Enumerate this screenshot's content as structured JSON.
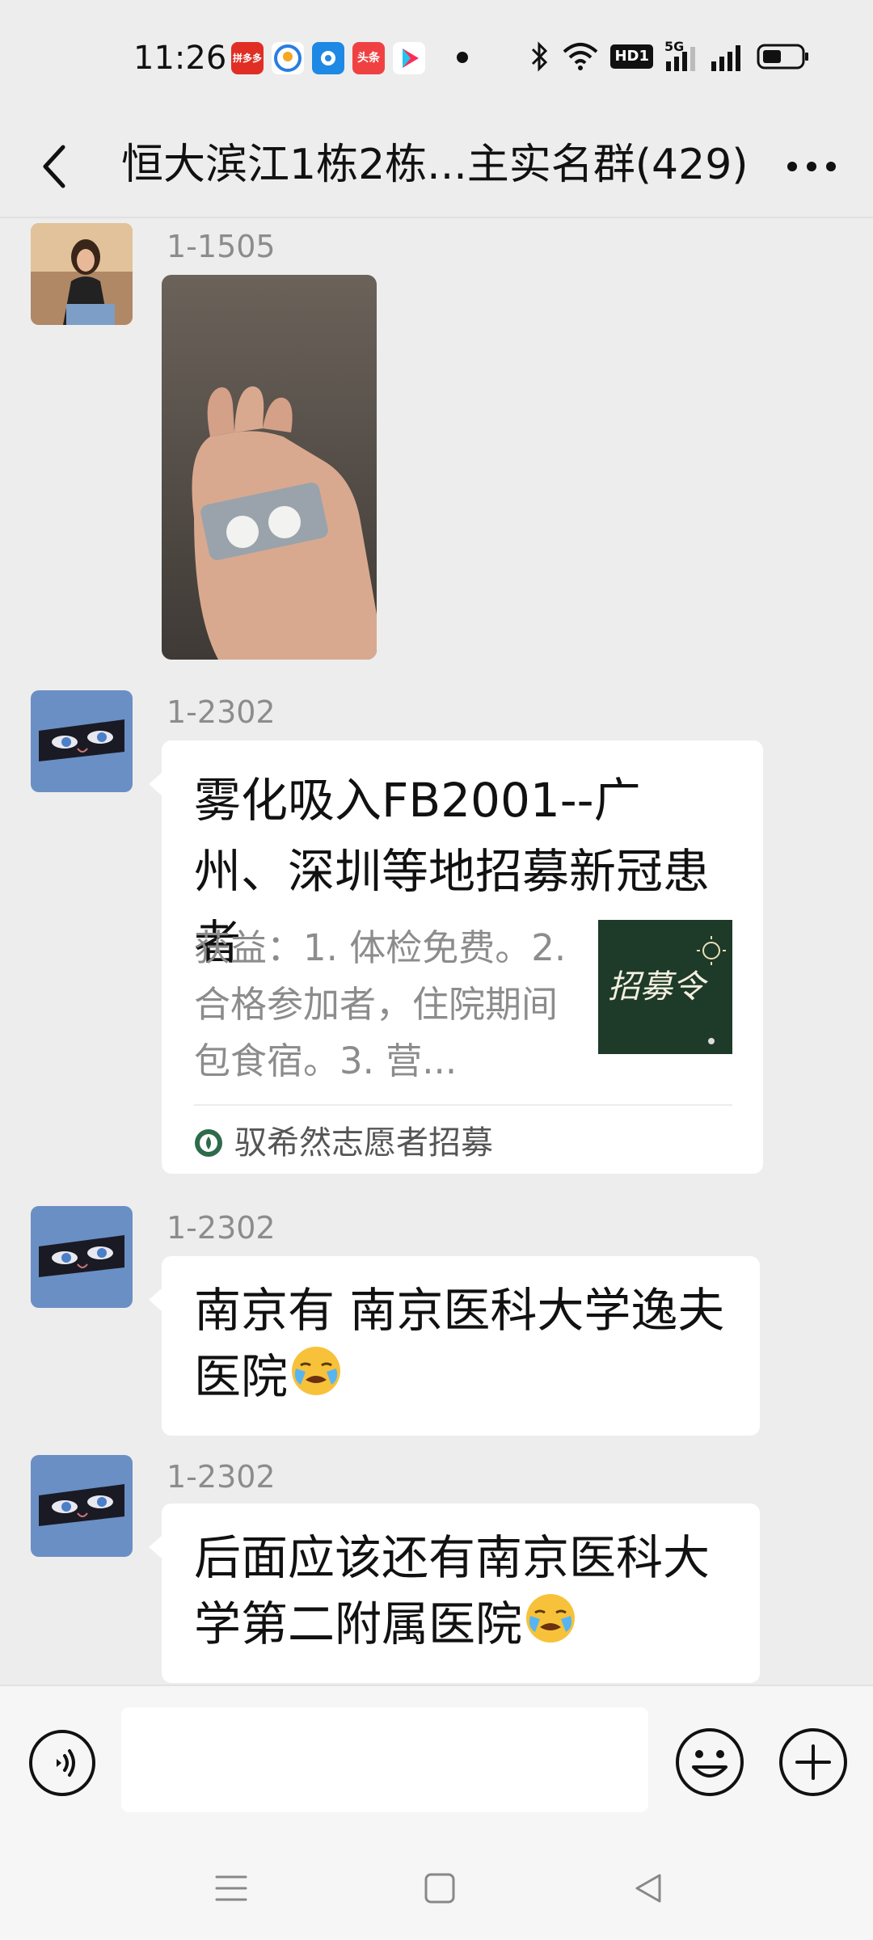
{
  "status_bar": {
    "time": "11:26",
    "notification_icons": [
      {
        "name": "app-icon-pinduoduo",
        "text": "拼多多",
        "color": "#e02e24"
      },
      {
        "name": "app-icon-baidu-map",
        "text": "",
        "color": "#ffffff"
      },
      {
        "name": "app-icon-browser",
        "text": "",
        "color": "#1e88e5"
      },
      {
        "name": "app-icon-toutiao",
        "text": "头条",
        "color": "#f04142"
      },
      {
        "name": "app-icon-video",
        "text": "",
        "color": "#ffffff"
      }
    ],
    "network_badge": "HD1",
    "network_type": "5G"
  },
  "header": {
    "title": "恒大滨江1栋2栋...主实名群(429)"
  },
  "messages": [
    {
      "type": "image",
      "sender": "1-1505"
    },
    {
      "type": "link",
      "sender": "1-2302",
      "title": "雾化吸入FB2001--广州、深圳等地招募新冠患者",
      "description": "获益：1. 体检免费。2. 合格参加者，住院期间包食宿。3. 营...",
      "thumbnail_text": "招募令",
      "source": "驭希然志愿者招募"
    },
    {
      "type": "text",
      "sender": "1-2302",
      "text": "南京有  南京医科大学逸夫医院",
      "emoji": "😭"
    },
    {
      "type": "text",
      "sender": "1-2302",
      "text": "后面应该还有南京医科大学第二附属医院",
      "emoji": "😭"
    }
  ],
  "input": {
    "placeholder": ""
  },
  "colors": {
    "chat_background": "#ededed",
    "bubble": "#ffffff",
    "sender_name": "#8c8c8c",
    "avatar_blue": "#6a8fc4"
  }
}
